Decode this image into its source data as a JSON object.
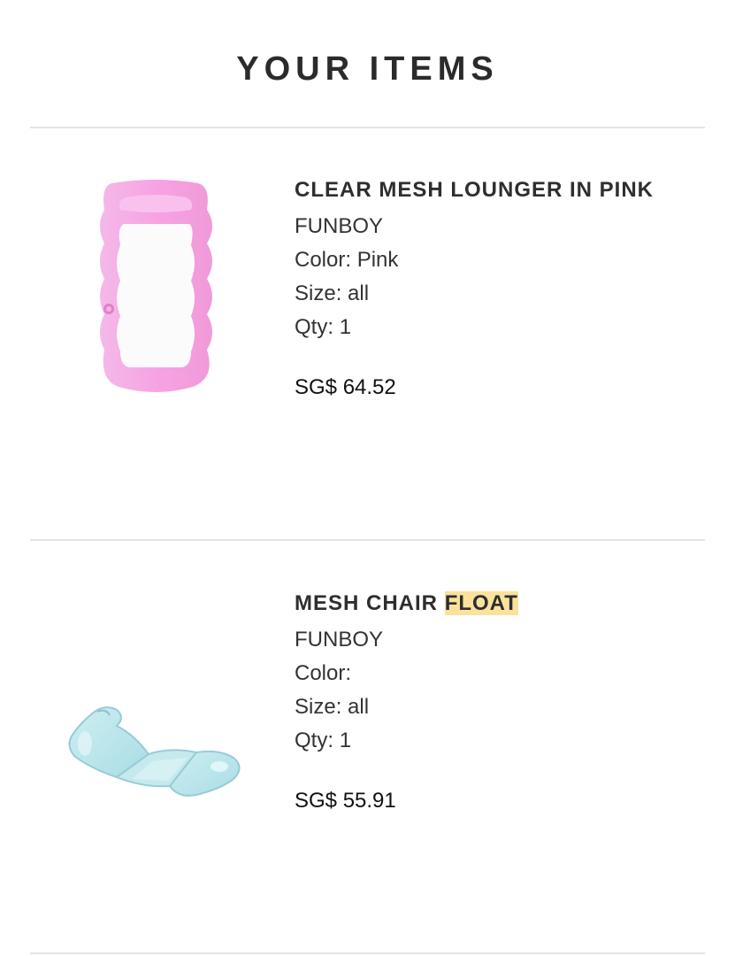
{
  "page": {
    "title": "YOUR ITEMS"
  },
  "items": [
    {
      "name": "CLEAR MESH LOUNGER IN PINK",
      "brand": "FUNBOY",
      "color_label": "Color:",
      "color_value": "Pink",
      "size_label": "Size:",
      "size_value": "all",
      "qty_label": "Qty:",
      "qty_value": "1",
      "price": "SG$ 64.52",
      "image_icon": "pink-mesh-lounger-image"
    },
    {
      "name_main": "MESH CHAIR",
      "name_highlight": "FLOAT",
      "brand": "FUNBOY",
      "color_label": "Color:",
      "color_value": "",
      "size_label": "Size:",
      "size_value": "all",
      "qty_label": "Qty:",
      "qty_value": "1",
      "price": "SG$ 55.91",
      "image_icon": "blue-mesh-chair-float-image"
    }
  ],
  "colors": {
    "highlight": "#fbe29c",
    "divider": "#e4e4e4",
    "lounger_pink": "#f5a6e4",
    "chair_blue": "#bfe5ea"
  }
}
